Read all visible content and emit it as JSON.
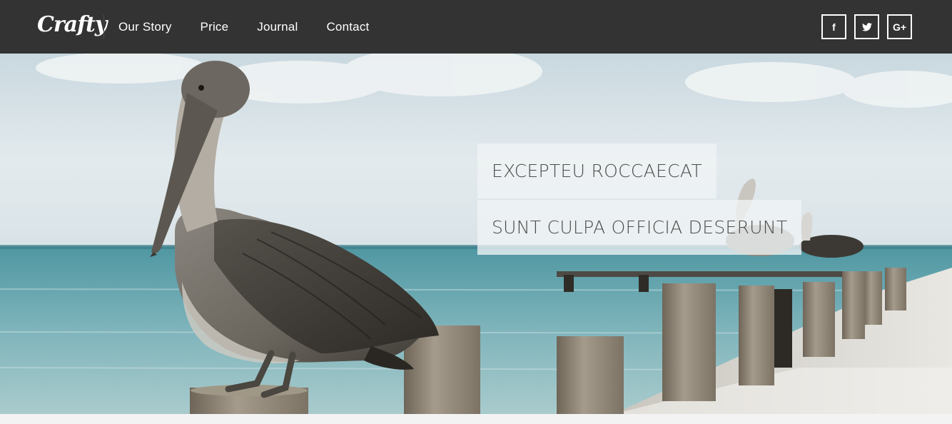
{
  "brand": {
    "logo_text": "Crafty"
  },
  "nav": {
    "items": [
      {
        "label": "Our Story"
      },
      {
        "label": "Price"
      },
      {
        "label": "Journal"
      },
      {
        "label": "Contact"
      }
    ]
  },
  "social": {
    "items": [
      {
        "label": "f",
        "icon": "facebook-icon"
      },
      {
        "label": "",
        "icon": "twitter-icon"
      },
      {
        "label": "G+",
        "icon": "google-plus-icon"
      }
    ]
  },
  "hero": {
    "caption_1": "EXCEPTEU ROCCAECAT",
    "caption_2": "SUNT CULPA OFFICIA DESERUNT"
  },
  "colors": {
    "nav_background": "#333333",
    "nav_text": "#ffffff",
    "caption_background": "#f0f3f5",
    "caption_text": "#4b4b4b"
  }
}
